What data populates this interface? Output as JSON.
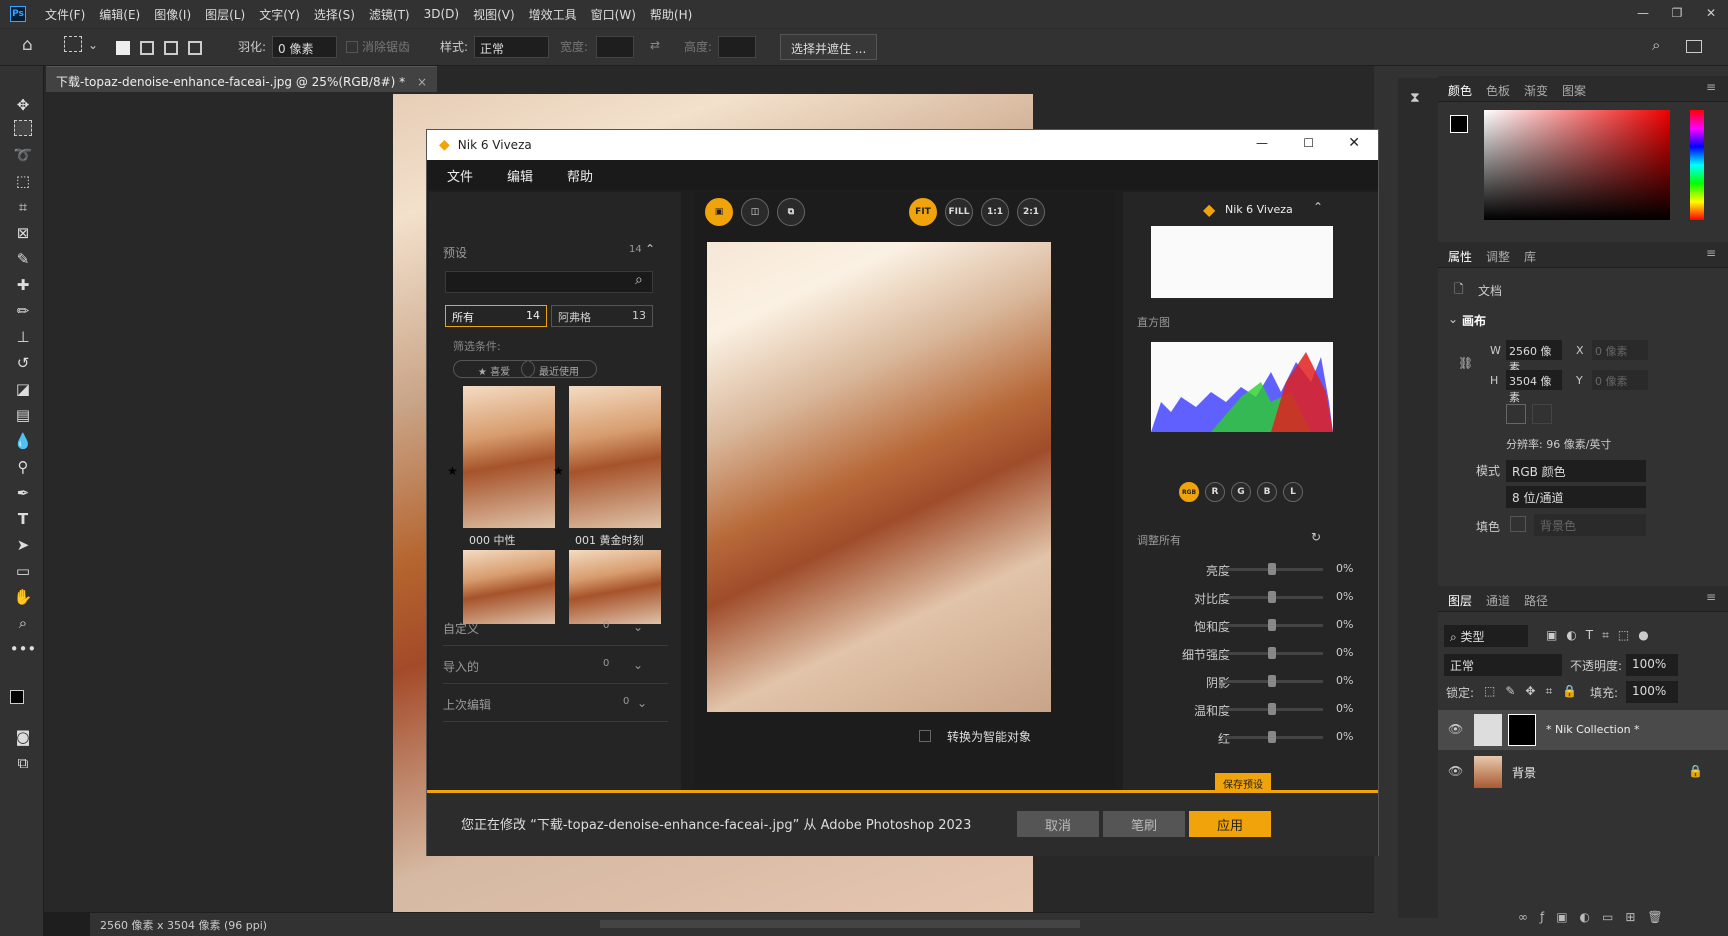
{
  "menubar": {
    "logo": "Ps",
    "items": [
      "文件(F)",
      "编辑(E)",
      "图像(I)",
      "图层(L)",
      "文字(Y)",
      "选择(S)",
      "滤镜(T)",
      "3D(D)",
      "视图(V)",
      "增效工具",
      "窗口(W)",
      "帮助(H)"
    ]
  },
  "options": {
    "feather_label": "羽化:",
    "feather_value": "0 像素",
    "antialias": "消除锯齿",
    "style_label": "样式:",
    "style_value": "正常",
    "width_label": "宽度:",
    "height_label": "高度:",
    "select_mask": "选择并遮住 ..."
  },
  "document": {
    "tab_title": "下载-topaz-denoise-enhance-faceai-.jpg @ 25%(RGB/8#) *",
    "status": "2560 像素 x 3504 像素 (96 ppi)"
  },
  "nik": {
    "title": "Nik 6 Viveza",
    "menu": [
      "文件",
      "编辑",
      "帮助"
    ],
    "left": {
      "presets_label": "预设",
      "presets_count": "14",
      "filter_all": "所有",
      "filter_all_count": "14",
      "filter_afu": "阿弗格",
      "filter_afu_count": "13",
      "filter_conditions": "筛选条件:",
      "fav": "★ 喜爱",
      "recent": "最近使用",
      "thumbs": [
        {
          "label": "000 中性"
        },
        {
          "label": "001 黄金时刻"
        },
        {
          "label": ""
        },
        {
          "label": ""
        }
      ],
      "custom": "自定义",
      "custom_count": "0",
      "imported": "导入的",
      "imported_count": "0",
      "last_edit": "上次编辑",
      "last_edit_count": "0"
    },
    "center": {
      "zoom_buttons": [
        "FIT",
        "FILL",
        "1:1",
        "2:1"
      ],
      "smart_object": "转换为智能对象"
    },
    "right": {
      "brand": "Nik 6 Viveza",
      "histogram_label": "直方图",
      "channels": [
        "RGB",
        "R",
        "G",
        "B",
        "L"
      ],
      "adjust_all": "调整所有",
      "sliders": [
        {
          "label": "亮度",
          "value": "0%"
        },
        {
          "label": "对比度",
          "value": "0%"
        },
        {
          "label": "饱和度",
          "value": "0%"
        },
        {
          "label": "细节强度",
          "value": "0%"
        },
        {
          "label": "阴影",
          "value": "0%"
        },
        {
          "label": "温和度",
          "value": "0%"
        },
        {
          "label": "红",
          "value": "0%"
        }
      ],
      "save_preset": "保存预设"
    },
    "footer": {
      "message": "您正在修改 “下载-topaz-denoise-enhance-faceai-.jpg” 从 Adobe Photoshop 2023",
      "cancel": "取消",
      "brush": "笔刷",
      "apply": "应用"
    }
  },
  "panels": {
    "color_tabs": [
      "颜色",
      "色板",
      "渐变",
      "图案"
    ],
    "props_tabs": [
      "属性",
      "调整",
      "库"
    ],
    "doc_label": "文档",
    "canvas_label": "画布",
    "w_label": "W",
    "w_value": "2560 像素",
    "h_label": "H",
    "h_value": "3504 像素",
    "x_label": "X",
    "x_value": "0 像素",
    "y_label": "Y",
    "y_value": "0 像素",
    "resolution": "分辨率: 96 像素/英寸",
    "mode_label": "模式",
    "mode_value": "RGB 颜色",
    "depth_value": "8 位/通道",
    "fill_label": "填色",
    "fill_value": "背景色",
    "layers_tabs": [
      "图层",
      "通道",
      "路径"
    ],
    "kind": "类型",
    "blend": "正常",
    "opacity_label": "不透明度:",
    "opacity_value": "100%",
    "lock_label": "锁定:",
    "fill2_label": "填充:",
    "fill2_value": "100%",
    "layers": [
      {
        "name": "* Nik Collection *"
      },
      {
        "name": "背景"
      }
    ]
  }
}
